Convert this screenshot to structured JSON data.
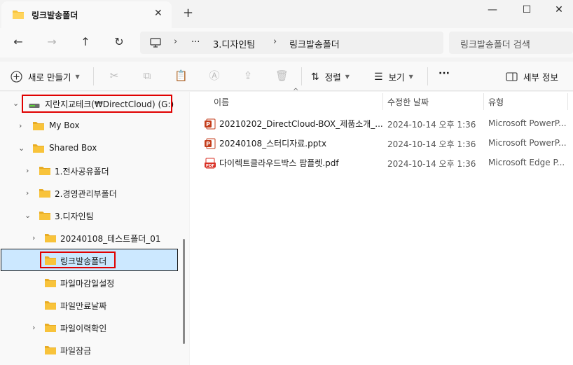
{
  "tab": {
    "title": "링크발송폴더",
    "close": "✕",
    "new_tab": "+"
  },
  "window": {
    "minimize": "—",
    "maximize": "☐",
    "close": "✕"
  },
  "nav": {
    "back": "←",
    "forward": "→",
    "up": "↑",
    "refresh": "↻",
    "breadcrumb": [
      "3.디자인팀",
      "링크발송폴더"
    ],
    "breadcrumb_more": "···",
    "breadcrumb_sep": "›",
    "search_placeholder": "링크발송폴더 검색"
  },
  "commandbar": {
    "new_label": "새로 만들기",
    "sort_label": "정렬",
    "view_label": "보기",
    "more": "···",
    "details_label": "세부 정보"
  },
  "tree": {
    "drive": "지란지교테크(₩DirectCloud) (G:)",
    "items": [
      "My Box",
      "Shared Box",
      "1.전사공유폴더",
      "2.경영관리부폴더",
      "3.디자인팀",
      "20240108_테스트폴더_01",
      "링크발송폴더",
      "파일마감일설정",
      "파일만료날짜",
      "파일이력확인",
      "파일잠금"
    ]
  },
  "columns": {
    "name": "이름",
    "modified": "수정한 날짜",
    "type": "유형"
  },
  "files": [
    {
      "name": "20210202_DirectCloud-BOX_제품소개_...",
      "modified": "2024-10-14 오후 1:36",
      "type": "Microsoft PowerP...",
      "icon": "pptx-icon"
    },
    {
      "name": "20240108_스터디자료.pptx",
      "modified": "2024-10-14 오후 1:36",
      "type": "Microsoft PowerP...",
      "icon": "pptx-icon"
    },
    {
      "name": "다이렉트클라우드박스 팜플렛.pdf",
      "modified": "2024-10-14 오후 1:36",
      "type": "Microsoft Edge P...",
      "icon": "pdf-icon"
    }
  ],
  "colors": {
    "folder": "#f8c33b",
    "selection": "#cce8ff",
    "highlight_box": "#e00000",
    "pptx": "#c43e1c",
    "pdf": "#d93025"
  }
}
